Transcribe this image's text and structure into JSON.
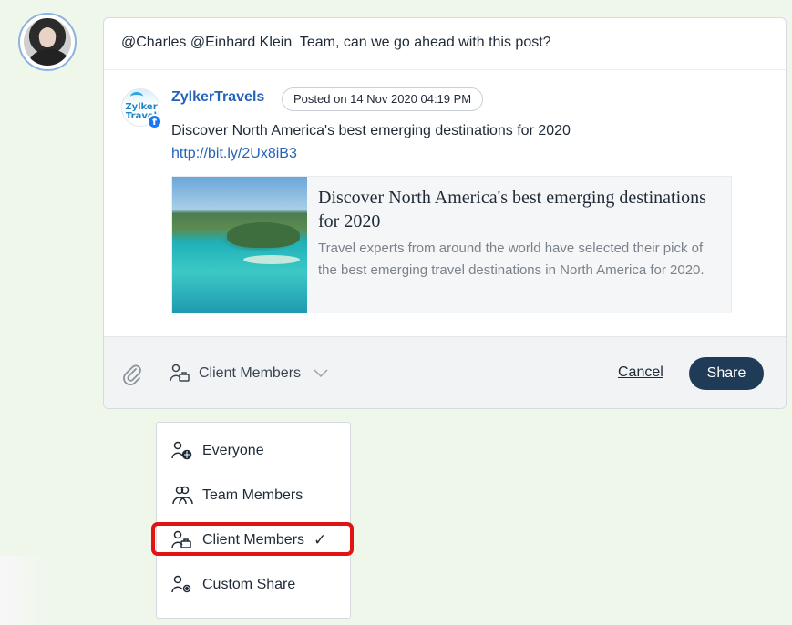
{
  "comment": {
    "message": "@Charles @Einhard Klein  Team, can we go ahead with this post?"
  },
  "post": {
    "brand_name": "ZylkerTravels",
    "brand_logo_text": "Zylker Travel",
    "network_icon": "facebook-icon",
    "posted_label": "Posted on 14 Nov 2020 04:19 PM",
    "text": "Discover North America's best emerging destinations for 2020",
    "link": "http://bit.ly/2Ux8iB3"
  },
  "preview": {
    "title": "Discover North America's best emerging destinations for 2020",
    "description": "Travel experts from around the world have selected their pick of the best emerging travel destinations in North America for 2020."
  },
  "toolbar": {
    "attach_icon": "paperclip-icon",
    "audience_selected": "Client Members",
    "cancel_label": "Cancel",
    "share_label": "Share"
  },
  "audience_menu": {
    "items": [
      {
        "label": "Everyone",
        "icon": "globe-user-icon",
        "selected": false
      },
      {
        "label": "Team Members",
        "icon": "team-icon",
        "selected": false
      },
      {
        "label": "Client Members",
        "icon": "client-user-icon",
        "selected": true
      },
      {
        "label": "Custom Share",
        "icon": "custom-user-icon",
        "selected": false
      }
    ],
    "checkmark": "✓"
  },
  "colors": {
    "page_bg": "#eef7ea",
    "link_blue": "#2563b8",
    "share_button": "#1f3b57",
    "highlight_red": "#e11313"
  }
}
